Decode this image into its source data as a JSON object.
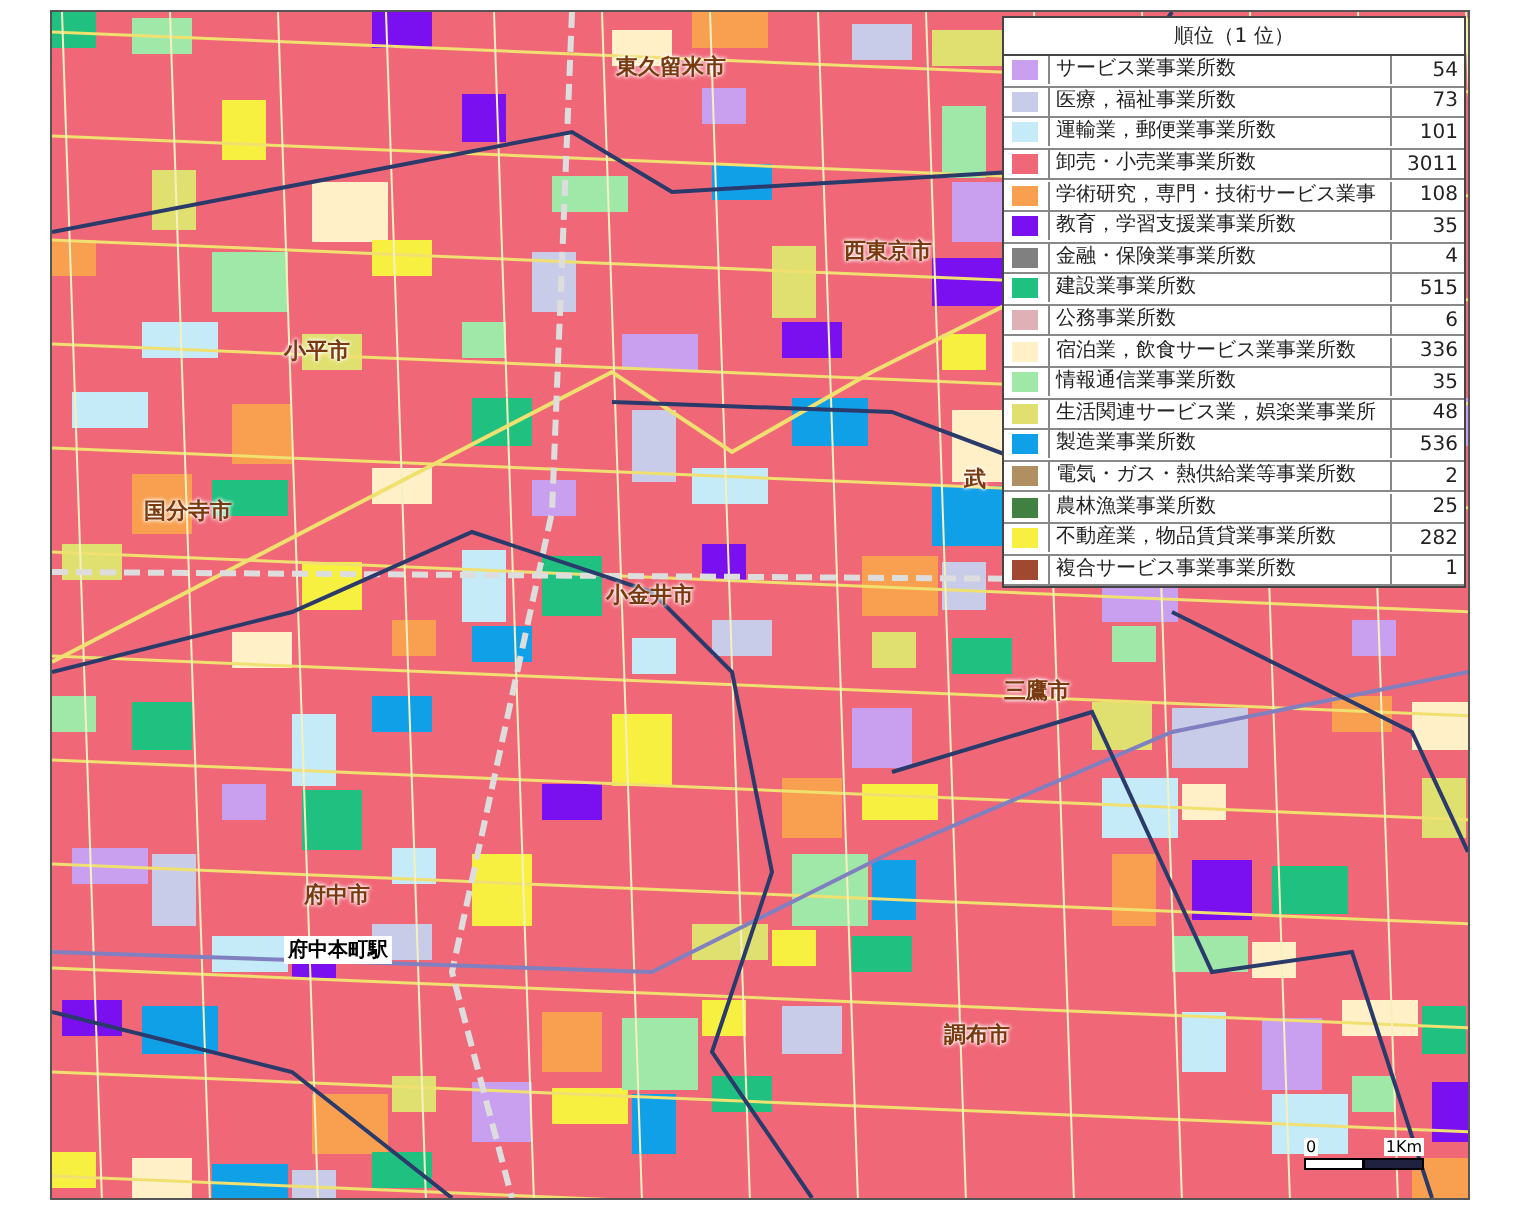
{
  "map": {
    "place_labels": [
      {
        "text": "東久留米市",
        "kind": "city"
      },
      {
        "text": "西東京市",
        "kind": "city"
      },
      {
        "text": "小平市",
        "kind": "city"
      },
      {
        "text": "国分寺市",
        "kind": "city"
      },
      {
        "text": "武",
        "kind": "city"
      },
      {
        "text": "小金井市",
        "kind": "city"
      },
      {
        "text": "三鷹市",
        "kind": "city"
      },
      {
        "text": "府中市",
        "kind": "city"
      },
      {
        "text": "府中本町駅",
        "kind": "station"
      },
      {
        "text": "調布市",
        "kind": "city"
      }
    ],
    "scale": {
      "start": "0",
      "end": "1Km"
    }
  },
  "legend": {
    "title": "順位（1 位）",
    "items": [
      {
        "label": "サービス業事業所数",
        "count": "54",
        "color": "#c9a0f0"
      },
      {
        "label": "医療，福祉事業所数",
        "count": "73",
        "color": "#c8cce8"
      },
      {
        "label": "運輸業，郵便業事業所数",
        "count": "101",
        "color": "#c5eaf8"
      },
      {
        "label": "卸売・小売業事業所数",
        "count": "3011",
        "color": "#f06878"
      },
      {
        "label": "学術研究，専門・技術サービス業事",
        "count": "108",
        "color": "#f8a050"
      },
      {
        "label": "教育，学習支援業事業所数",
        "count": "35",
        "color": "#7a10f0"
      },
      {
        "label": "金融・保険業事業所数",
        "count": "4",
        "color": "#808080"
      },
      {
        "label": "建設業事業所数",
        "count": "515",
        "color": "#20c080"
      },
      {
        "label": "公務事業所数",
        "count": "6",
        "color": "#e0b0b8"
      },
      {
        "label": "宿泊業，飲食サービス業事業所数",
        "count": "336",
        "color": "#fff0c8"
      },
      {
        "label": "情報通信業事業所数",
        "count": "35",
        "color": "#a0e8a8"
      },
      {
        "label": "生活関連サービス業，娯楽業事業所",
        "count": "48",
        "color": "#e0e070"
      },
      {
        "label": "製造業事業所数",
        "count": "536",
        "color": "#10a0e8"
      },
      {
        "label": "電気・ガス・熱供給業等事業所数",
        "count": "2",
        "color": "#b09060"
      },
      {
        "label": "農林漁業事業所数",
        "count": "25",
        "color": "#408040"
      },
      {
        "label": "不動産業，物品賃貸業事業所数",
        "count": "282",
        "color": "#f8f040"
      },
      {
        "label": "複合サービス事業事業所数",
        "count": "1",
        "color": "#a04830"
      }
    ]
  }
}
